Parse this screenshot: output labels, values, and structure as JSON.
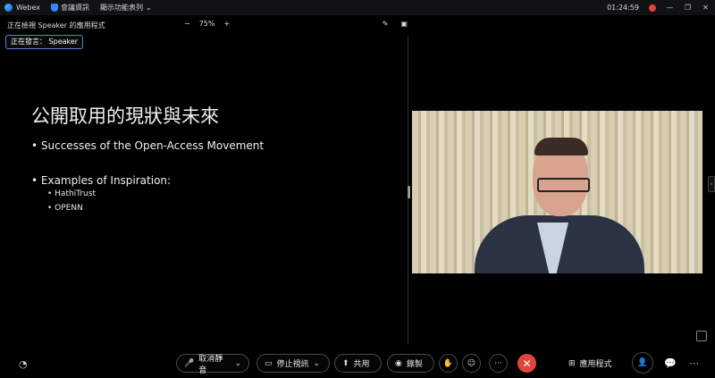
{
  "titlebar": {
    "app_name": "Webex",
    "meeting_info": "會議資訊",
    "show_menu": "顯示功能表列",
    "time": "01:24:59",
    "min_glyph": "—",
    "restore_glyph": "❐",
    "close_glyph": "✕"
  },
  "share": {
    "viewing_label": "正在檢視 Speaker 的應用程式",
    "zoom_minus": "−",
    "zoom_level": "75%",
    "zoom_plus": "+",
    "presenter_label": "正在發言： Speaker"
  },
  "slide": {
    "title": "公開取用的現狀與未來",
    "bullet1": "• Successes of the Open-Access Movement",
    "bullet2": "• Examples of Inspiration:",
    "sub1": "• HathiTrust",
    "sub2": "• OPENN"
  },
  "controls": {
    "unmute": "取消靜音",
    "stop_video": "停止視訊",
    "share": "共用",
    "record": "錄製",
    "more": "···",
    "end_glyph": "✕",
    "apps": "應用程式"
  },
  "colors": {
    "accent": "#3a86ff",
    "end_call": "#e2453d",
    "background": "#000000"
  }
}
